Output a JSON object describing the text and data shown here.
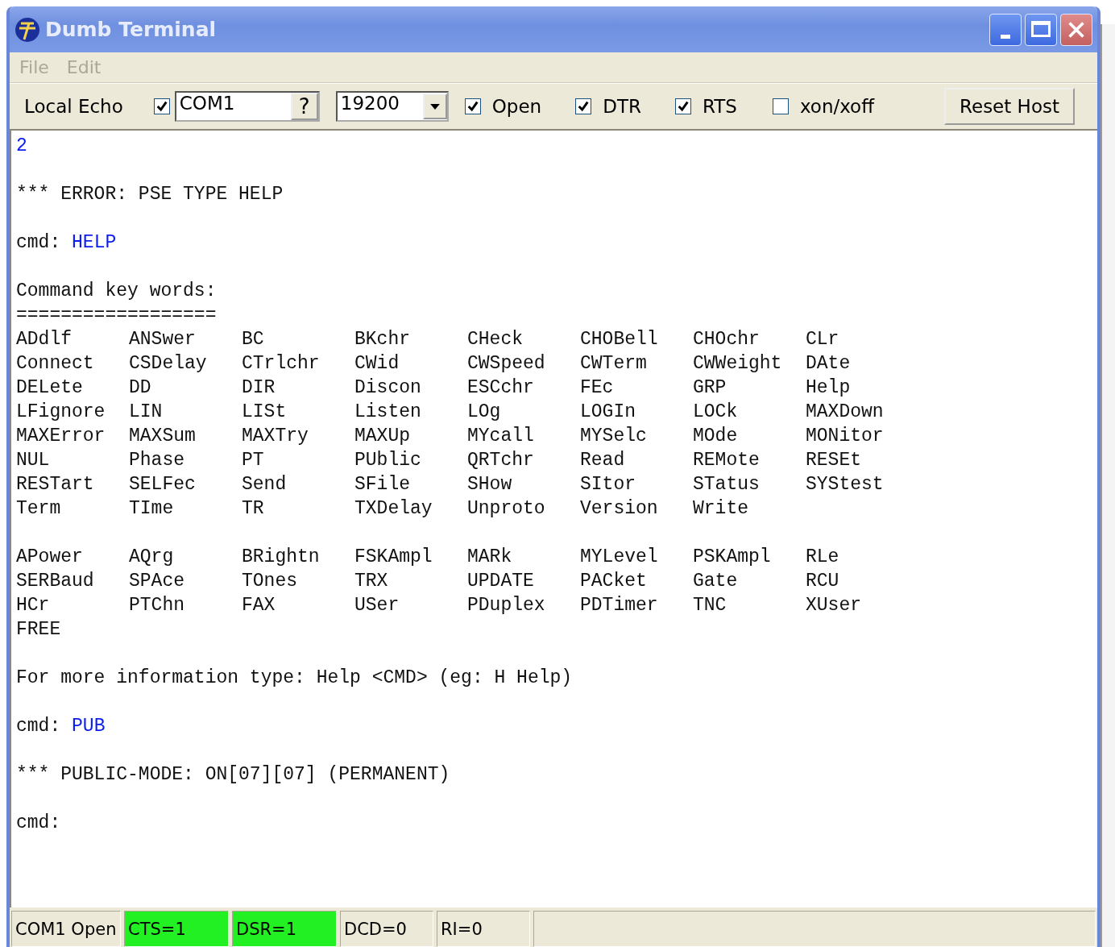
{
  "window": {
    "title": "Dumb Terminal"
  },
  "menu": [
    "File",
    "Edit"
  ],
  "toolbar": {
    "local_echo": {
      "label": "Local Echo",
      "checked": true
    },
    "port": {
      "value": "COM1",
      "help": "?"
    },
    "baud": {
      "value": "19200"
    },
    "checks": [
      {
        "label": "Open",
        "checked": true
      },
      {
        "label": "DTR",
        "checked": true
      },
      {
        "label": "RTS",
        "checked": true
      },
      {
        "label": "xon/xoff",
        "checked": false
      }
    ],
    "reset_button": "Reset Host"
  },
  "terminal": [
    {
      "kind": "input",
      "text": "2"
    },
    {
      "kind": "blank"
    },
    {
      "kind": "text",
      "text": "*** ERROR: PSE TYPE HELP"
    },
    {
      "kind": "blank"
    },
    {
      "kind": "cmd",
      "prompt": "cmd:",
      "input": "HELP"
    },
    {
      "kind": "blank"
    },
    {
      "kind": "text",
      "text": "Command key words:"
    },
    {
      "kind": "text",
      "text": "=================="
    },
    {
      "kind": "keywords",
      "rows": [
        [
          "ADdlf",
          "ANSwer",
          "BC",
          "BKchr",
          "CHeck",
          "CHOBell",
          "CHOchr",
          "CLr"
        ],
        [
          "Connect",
          "CSDelay",
          "CTrlchr",
          "CWid",
          "CWSpeed",
          "CWTerm",
          "CWWeight",
          "DAte"
        ],
        [
          "DELete",
          "DD",
          "DIR",
          "Discon",
          "ESCchr",
          "FEc",
          "GRP",
          "Help"
        ],
        [
          "LFignore",
          "LIN",
          "LISt",
          "Listen",
          "LOg",
          "LOGIn",
          "LOCk",
          "MAXDown"
        ],
        [
          "MAXError",
          "MAXSum",
          "MAXTry",
          "MAXUp",
          "MYcall",
          "MYSelc",
          "MOde",
          "MONitor"
        ],
        [
          "NUL",
          "Phase",
          "PT",
          "PUblic",
          "QRTchr",
          "Read",
          "REMote",
          "RESEt"
        ],
        [
          "RESTart",
          "SELFec",
          "Send",
          "SFile",
          "SHow",
          "SItor",
          "STatus",
          "SYStest"
        ],
        [
          "Term",
          "TIme",
          "TR",
          "TXDelay",
          "Unproto",
          "Version",
          "Write"
        ]
      ]
    },
    {
      "kind": "blank"
    },
    {
      "kind": "keywords",
      "rows": [
        [
          "APower",
          "AQrg",
          "BRightn",
          "FSKAmpl",
          "MARk",
          "MYLevel",
          "PSKAmpl",
          "RLe"
        ],
        [
          "SERBaud",
          "SPAce",
          "TOnes",
          "TRX",
          "UPDATE",
          "PACket",
          "Gate",
          "RCU"
        ],
        [
          "HCr",
          "PTChn",
          "FAX",
          "USer",
          "PDuplex",
          "PDTimer",
          "TNC",
          "XUser"
        ],
        [
          "FREE"
        ]
      ]
    },
    {
      "kind": "blank"
    },
    {
      "kind": "text",
      "text": "For more information type: Help <CMD> (eg: H Help)"
    },
    {
      "kind": "blank"
    },
    {
      "kind": "cmd",
      "prompt": "cmd:",
      "input": "PUB"
    },
    {
      "kind": "blank"
    },
    {
      "kind": "text",
      "text": "*** PUBLIC-MODE: ON[07][07] (PERMANENT)"
    },
    {
      "kind": "blank"
    },
    {
      "kind": "text",
      "text": "cmd:"
    }
  ],
  "status_bar": [
    {
      "text": "COM1 Open",
      "lit": false
    },
    {
      "text": "CTS=1",
      "lit": true
    },
    {
      "text": "DSR=1",
      "lit": true
    },
    {
      "text": "DCD=0",
      "lit": false
    },
    {
      "text": "RI=0",
      "lit": false
    }
  ]
}
